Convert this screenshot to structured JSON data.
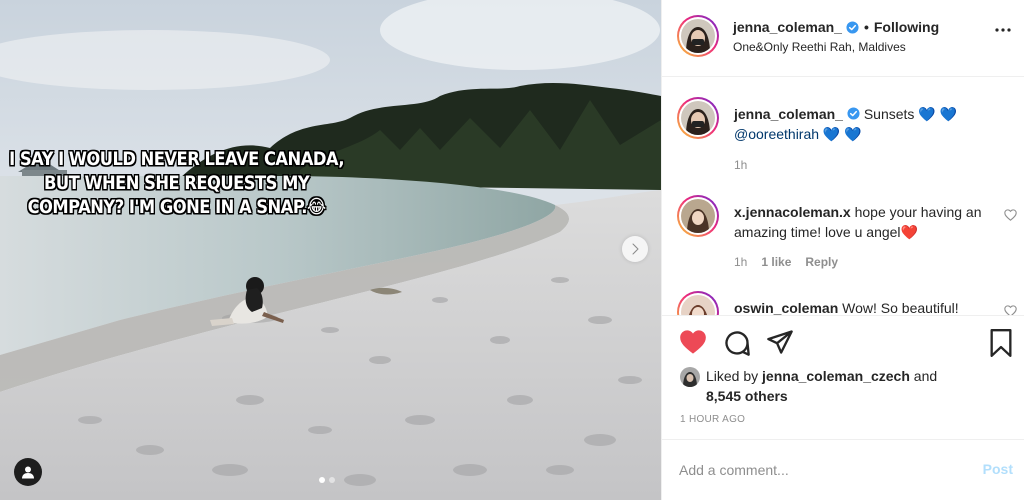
{
  "meme_caption": "I SAY I WOULD NEVER LEAVE CANADA, BUT WHEN SHE REQUESTS MY COMPANY? I'M GONE IN A SNAP.😂",
  "header": {
    "username": "jenna_coleman_",
    "separator": "•",
    "follow_status": "Following",
    "location": "One&Only Reethi Rah, Maldives"
  },
  "caption": {
    "username": "jenna_coleman_",
    "text": "Sunsets 💙 💙",
    "mention": "@ooreethirah",
    "mention_suffix": " 💙 💙",
    "time": "1h"
  },
  "comments": [
    {
      "username": "x.jennacoleman.x",
      "text": "hope your having an amazing time! love u angel❤️",
      "time": "1h",
      "likes": "1 like",
      "reply": "Reply"
    },
    {
      "username": "oswin_coleman",
      "text": "Wow! So beautiful!"
    }
  ],
  "likes": {
    "prefix": "Liked by",
    "liker": "jenna_coleman_czech",
    "conj": "and",
    "others": "8,545 others"
  },
  "timestamp": "1 HOUR AGO",
  "add_comment": {
    "placeholder": "Add a comment...",
    "post_label": "Post"
  },
  "colors": {
    "like_red": "#ed4956",
    "verified_blue": "#3897f0",
    "post_disabled": "#b2dffc"
  }
}
